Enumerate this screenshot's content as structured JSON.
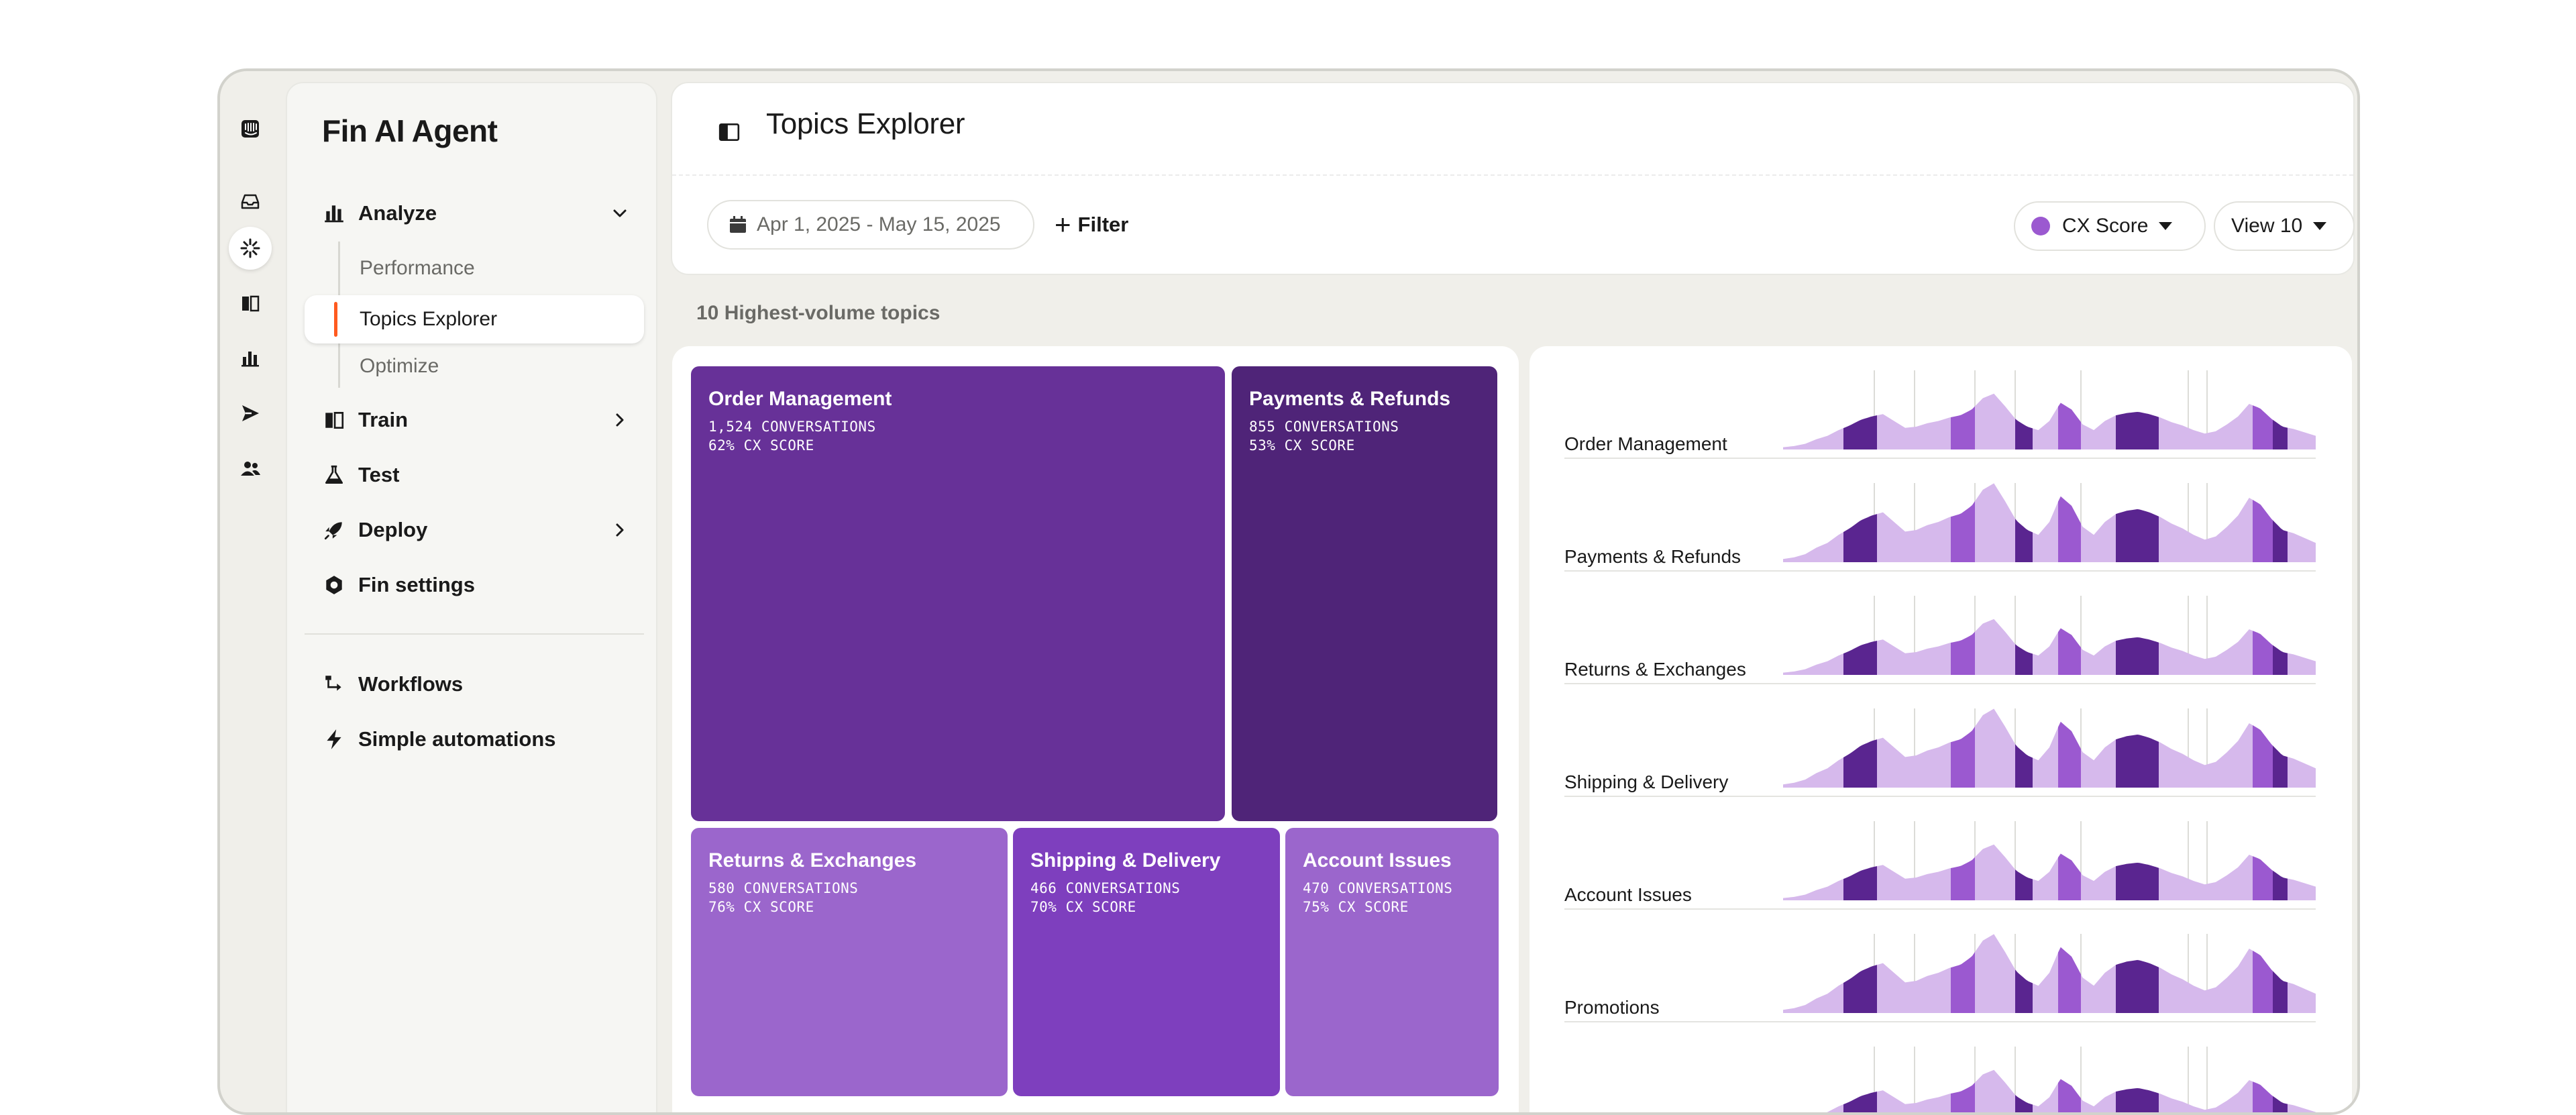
{
  "nav": {
    "title": "Fin AI Agent",
    "analyze": "Analyze",
    "sub": {
      "performance": "Performance",
      "topics": "Topics Explorer",
      "optimize": "Optimize"
    },
    "train": "Train",
    "test": "Test",
    "deploy": "Deploy",
    "settings": "Fin settings",
    "workflows": "Workflows",
    "automations": "Simple automations"
  },
  "header": {
    "title": "Topics Explorer",
    "date_range": "Apr 1, 2025 - May 15, 2025",
    "filter": "Filter",
    "metric": "CX Score",
    "view": "View 10"
  },
  "section_label": "10 Highest-volume topics",
  "topics": [
    {
      "name": "Order Management",
      "conversations": "1,524 CONVERSATIONS",
      "cx": "62% CX SCORE",
      "color": "#673198"
    },
    {
      "name": "Payments & Refunds",
      "conversations": "855 CONVERSATIONS",
      "cx": "53% CX SCORE",
      "color": "#4f2478"
    },
    {
      "name": "Returns & Exchanges",
      "conversations": "580 CONVERSATIONS",
      "cx": "76% CX SCORE",
      "color": "#9b66cc"
    },
    {
      "name": "Shipping & Delivery",
      "conversations": "466 CONVERSATIONS",
      "cx": "70% CX SCORE",
      "color": "#7e3fbe"
    },
    {
      "name": "Account Issues",
      "conversations": "470 CONVERSATIONS",
      "cx": "75% CX SCORE",
      "color": "#9b66cc"
    }
  ],
  "sparklines": [
    {
      "label": "Order Management"
    },
    {
      "label": "Payments & Refunds"
    },
    {
      "label": "Returns & Exchanges"
    },
    {
      "label": "Shipping & Delivery"
    },
    {
      "label": "Account Issues"
    },
    {
      "label": "Promotions"
    },
    {
      "label": ""
    }
  ],
  "colors": {
    "light": "#d6b9ec",
    "mid": "#9b59d0",
    "dark": "#5a2590"
  },
  "icons": [
    "inbox-icon",
    "fin-icon",
    "book-icon",
    "reports-icon",
    "outbound-icon",
    "contacts-icon"
  ]
}
